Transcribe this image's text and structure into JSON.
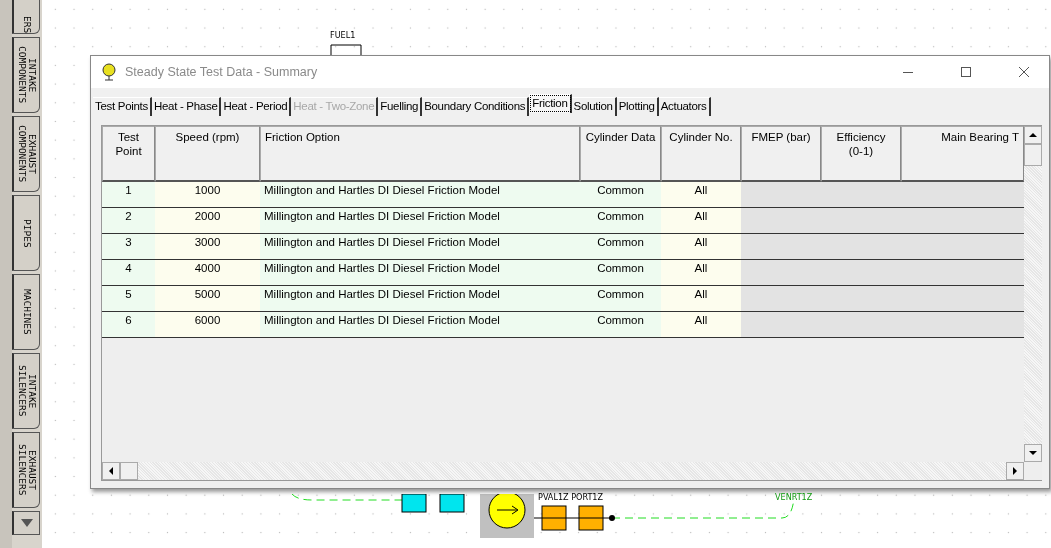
{
  "sidebar": {
    "tabs": [
      {
        "label": "ERS"
      },
      {
        "label": "INTAKE\nCOMPONENTS"
      },
      {
        "label": "EXHAUST\nCOMPONENTS"
      },
      {
        "label": "PIPES"
      },
      {
        "label": "MACHINES"
      },
      {
        "label": "INTAKE\nSILENCERS"
      },
      {
        "label": "EXHAUST\nSILENCERS"
      }
    ]
  },
  "canvas": {
    "fuel_label": "FUEL1",
    "port_label": "PVAL1Z PORT1Z",
    "vent_label": "VENRT1Z"
  },
  "dialog": {
    "title": "Steady State Test Data - Summary",
    "tabs": [
      {
        "label": "Test Points",
        "selected": false,
        "disabled": false
      },
      {
        "label": "Heat - Phase",
        "selected": false,
        "disabled": false
      },
      {
        "label": "Heat - Period",
        "selected": false,
        "disabled": false
      },
      {
        "label": "Heat - Two-Zone",
        "selected": false,
        "disabled": true
      },
      {
        "label": "Fuelling",
        "selected": false,
        "disabled": false
      },
      {
        "label": "Boundary Conditions",
        "selected": false,
        "disabled": false
      },
      {
        "label": "Friction",
        "selected": true,
        "disabled": false
      },
      {
        "label": "Solution",
        "selected": false,
        "disabled": false
      },
      {
        "label": "Plotting",
        "selected": false,
        "disabled": false
      },
      {
        "label": "Actuators",
        "selected": false,
        "disabled": false
      }
    ],
    "table": {
      "columns": [
        {
          "label": "Test\nPoint",
          "kind": "green"
        },
        {
          "label": "Speed (rpm)",
          "kind": "yellow"
        },
        {
          "label": "Friction Option",
          "kind": "green"
        },
        {
          "label": "Cylinder Data",
          "kind": "green"
        },
        {
          "label": "Cylinder No.",
          "kind": "yellow"
        },
        {
          "label": "FMEP (bar)",
          "kind": "grey"
        },
        {
          "label": "Efficiency\n(0-1)",
          "kind": "grey"
        },
        {
          "label": "Main Bearing T",
          "kind": "grey"
        }
      ],
      "rows": [
        [
          "1",
          "1000",
          "Millington and Hartles DI Diesel Friction Model",
          "Common",
          "All"
        ],
        [
          "2",
          "2000",
          "Millington and Hartles DI Diesel Friction Model",
          "Common",
          "All"
        ],
        [
          "3",
          "3000",
          "Millington and Hartles DI Diesel Friction Model",
          "Common",
          "All"
        ],
        [
          "4",
          "4000",
          "Millington and Hartles DI Diesel Friction Model",
          "Common",
          "All"
        ],
        [
          "5",
          "5000",
          "Millington and Hartles DI Diesel Friction Model",
          "Common",
          "All"
        ],
        [
          "6",
          "6000",
          "Millington and Hartles DI Diesel Friction Model",
          "Common",
          "All"
        ]
      ]
    }
  }
}
